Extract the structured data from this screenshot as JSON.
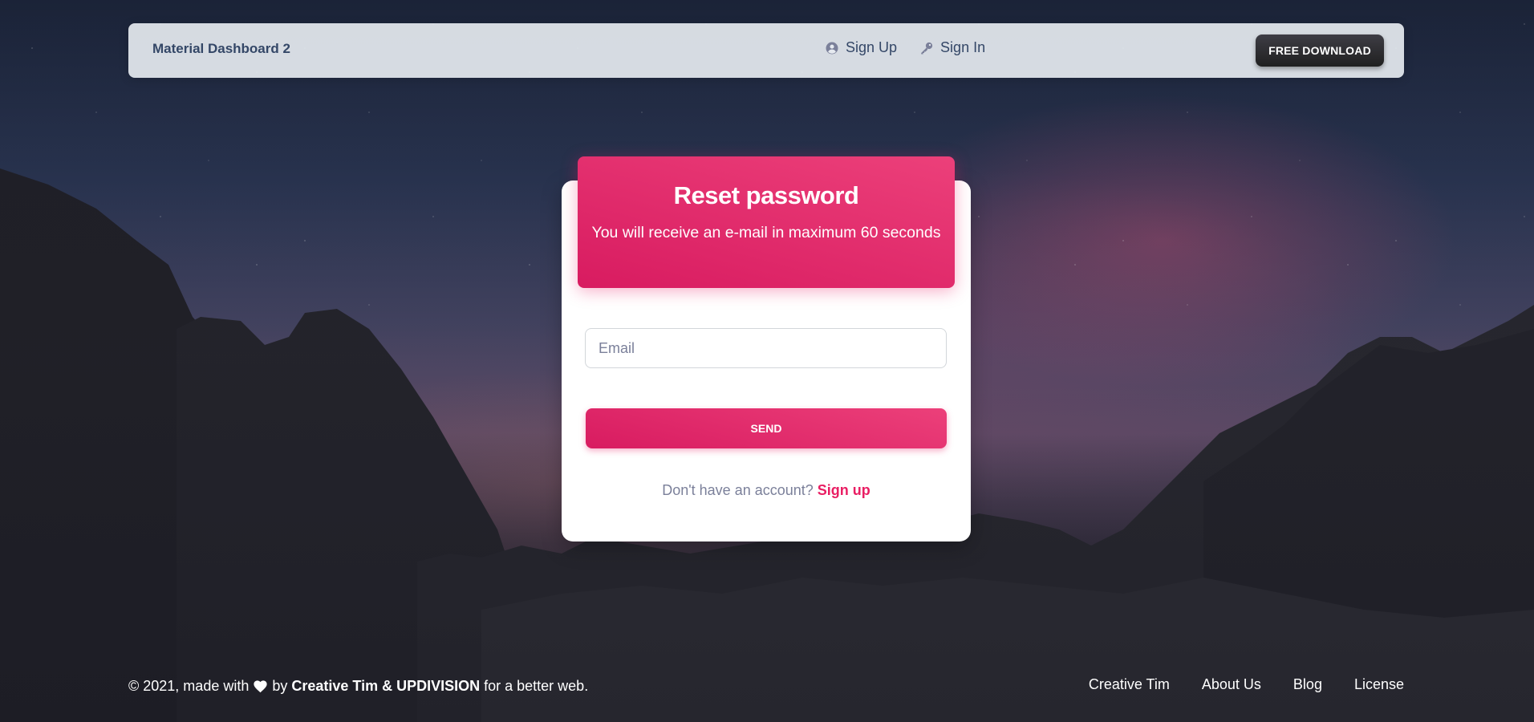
{
  "navbar": {
    "brand": "Material Dashboard 2",
    "links": [
      {
        "label": "Sign Up",
        "icon": "account-circle-icon"
      },
      {
        "label": "Sign In",
        "icon": "key-icon"
      }
    ],
    "download_label": "FREE DOWNLOAD"
  },
  "card": {
    "title": "Reset password",
    "subtitle": "You will receive an e-mail in maximum 60 seconds",
    "email_placeholder": "Email",
    "send_label": "SEND",
    "signup_prompt": "Don't have an account?",
    "signup_link": "Sign up"
  },
  "footer": {
    "copyright_prefix": "© 2021, made with",
    "by": "by",
    "authors": "Creative Tim & UPDIVISION",
    "suffix": "for a better web.",
    "links": [
      "Creative Tim",
      "About Us",
      "Blog",
      "License"
    ]
  },
  "colors": {
    "accent": "#e91e63",
    "navbar_text": "#344767",
    "dark_button": "#202020"
  }
}
